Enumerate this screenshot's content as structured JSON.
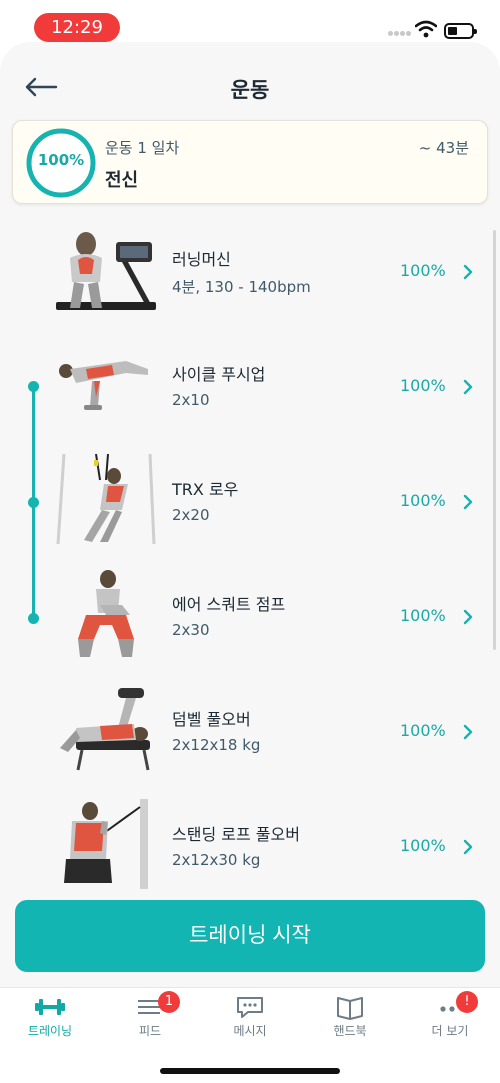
{
  "status_bar": {
    "time": "12:29"
  },
  "header": {
    "title": "운동"
  },
  "summary": {
    "progress": "100%",
    "day": "운동 1 일차",
    "duration": "~ 43분",
    "name": "전신"
  },
  "exercises": [
    {
      "name": "러닝머신",
      "detail": "4분, 130 - 140bpm",
      "percent": "100%",
      "image": "treadmill-illustration"
    },
    {
      "name": "사이클 푸시업",
      "detail": "2x10",
      "percent": "100%",
      "image": "pushup-illustration"
    },
    {
      "name": "TRX 로우",
      "detail": "2x20",
      "percent": "100%",
      "image": "trx-row-illustration"
    },
    {
      "name": "에어 스쿼트 점프",
      "detail": "2x30",
      "percent": "100%",
      "image": "squat-jump-illustration"
    },
    {
      "name": "덤벨 풀오버",
      "detail": "2x12x18 kg",
      "percent": "100%",
      "image": "dumbbell-pullover-illustration"
    },
    {
      "name": "스탠딩 로프 풀오버",
      "detail": "2x12x30 kg",
      "percent": "100%",
      "image": "rope-pullover-illustration"
    }
  ],
  "start_button": {
    "label": "트레이닝 시작"
  },
  "tab_bar": {
    "items": [
      {
        "label": "트레이닝",
        "icon": "dumbbell-icon",
        "active": true
      },
      {
        "label": "피드",
        "icon": "feed-icon",
        "badge": "1"
      },
      {
        "label": "메시지",
        "icon": "message-icon"
      },
      {
        "label": "핸드북",
        "icon": "book-icon"
      },
      {
        "label": "더 보기",
        "icon": "more-icon",
        "badge": "!"
      }
    ]
  },
  "colors": {
    "accent": "#12b5b2",
    "badge": "#f13b3b",
    "text": "#1e2a33",
    "subtext": "#405a6a"
  }
}
